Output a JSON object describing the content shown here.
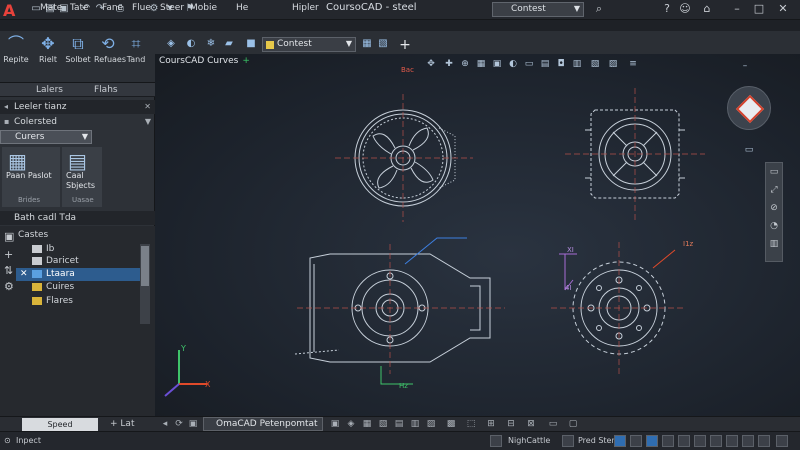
{
  "window": {
    "title": "CoursoCAD - steel",
    "workspace": "Contest",
    "menu": [
      "Mate",
      "Tate",
      "Fane",
      "Flue",
      "Steer",
      "Mobie",
      "He",
      "Hipler"
    ]
  },
  "ribbon": {
    "tools": [
      "Repite",
      "Rielt",
      "Solbet",
      "Refuaes",
      "Tand"
    ],
    "layer_value": "Contest",
    "colors": {
      "accent": "#2d5c8e",
      "layer_swatch": "#e6c84a",
      "logo": "#e8423b"
    }
  },
  "left_panel": {
    "tabs": [
      "Lalers",
      "Flahs"
    ],
    "header_1": "Leeler tianz",
    "row_1": "Colersted",
    "curves_dropdown": "Curers",
    "tool_cards": [
      {
        "label": "Paan Paslot",
        "icon": "palette-icon"
      },
      {
        "label": "Caal Sbjects",
        "icon": "clipboard-icon"
      }
    ],
    "tool_footers": [
      "Brides",
      "Uasae"
    ],
    "tree_header": "Bath cadl  Tda",
    "tree_rows": [
      {
        "label": "Castes",
        "indent": 0,
        "selected": false
      },
      {
        "label": "Ib",
        "indent": 1,
        "selected": false
      },
      {
        "label": "Daricet",
        "indent": 1,
        "selected": false
      },
      {
        "label": "Ltaara",
        "indent": 1,
        "selected": true
      },
      {
        "label": "Cuires",
        "indent": 1,
        "selected": false
      },
      {
        "label": "Flares",
        "indent": 1,
        "selected": false
      }
    ],
    "speed_button": "Speed",
    "lat_label": "Lat"
  },
  "canvas": {
    "doc_tab": "CoursCAD Curves",
    "tool_hint": "Bac",
    "annotations": [
      "I1z",
      "XI",
      "4I",
      "Hz"
    ],
    "axes": {
      "x": "X",
      "y": "Y"
    }
  },
  "model_tabs": {
    "layout": "OmaCAD Petenpomtat"
  },
  "status_bar": {
    "left": "Inpect",
    "items": [
      "NighCattle",
      "Pred Sten"
    ]
  }
}
